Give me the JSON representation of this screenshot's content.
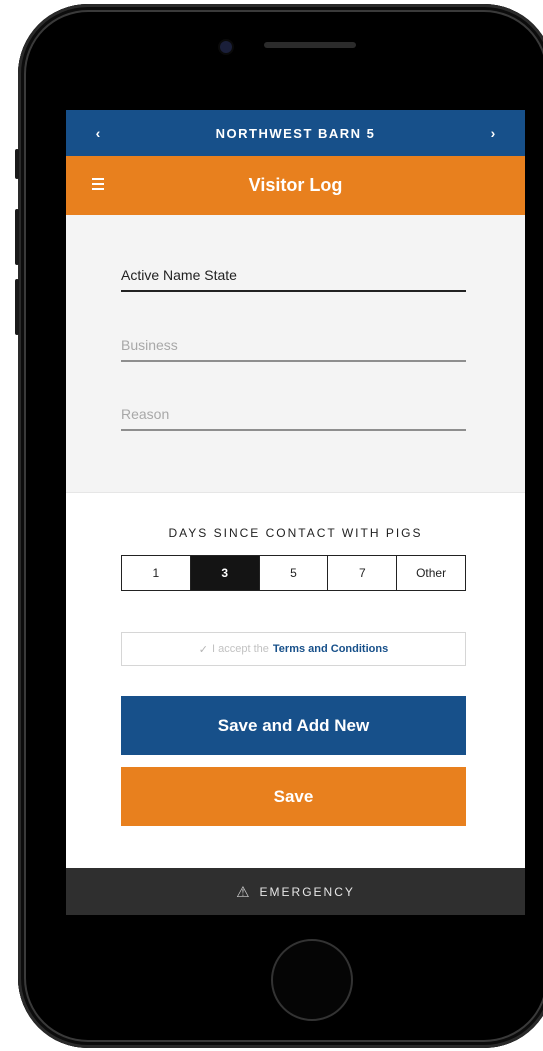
{
  "nav": {
    "barn_name": "NORTHWEST BARN 5",
    "prev_icon": "chevron-left-icon",
    "next_icon": "chevron-right-icon",
    "prev_glyph": "‹",
    "next_glyph": "›"
  },
  "header": {
    "title": "Visitor Log",
    "menu_icon": "hamburger-menu-icon"
  },
  "form": {
    "name_value": "Active Name State",
    "business_placeholder": "Business",
    "reason_placeholder": "Reason"
  },
  "days": {
    "label": "DAYS SINCE CONTACT WITH PIGS",
    "options": [
      "1",
      "3",
      "5",
      "7",
      "Other"
    ],
    "selected": "3"
  },
  "terms": {
    "check_glyph": "✓",
    "prefix": "I accept the",
    "link": "Terms and Conditions"
  },
  "buttons": {
    "save_and_add_new": "Save and Add New",
    "save": "Save"
  },
  "footer": {
    "emergency_label": "EMERGENCY",
    "warning_glyph": "⚠",
    "warning_icon": "warning-icon"
  },
  "colors": {
    "nav_blue": "#17508a",
    "header_orange": "#e8801e",
    "footer_dark": "#2f2f2f"
  }
}
